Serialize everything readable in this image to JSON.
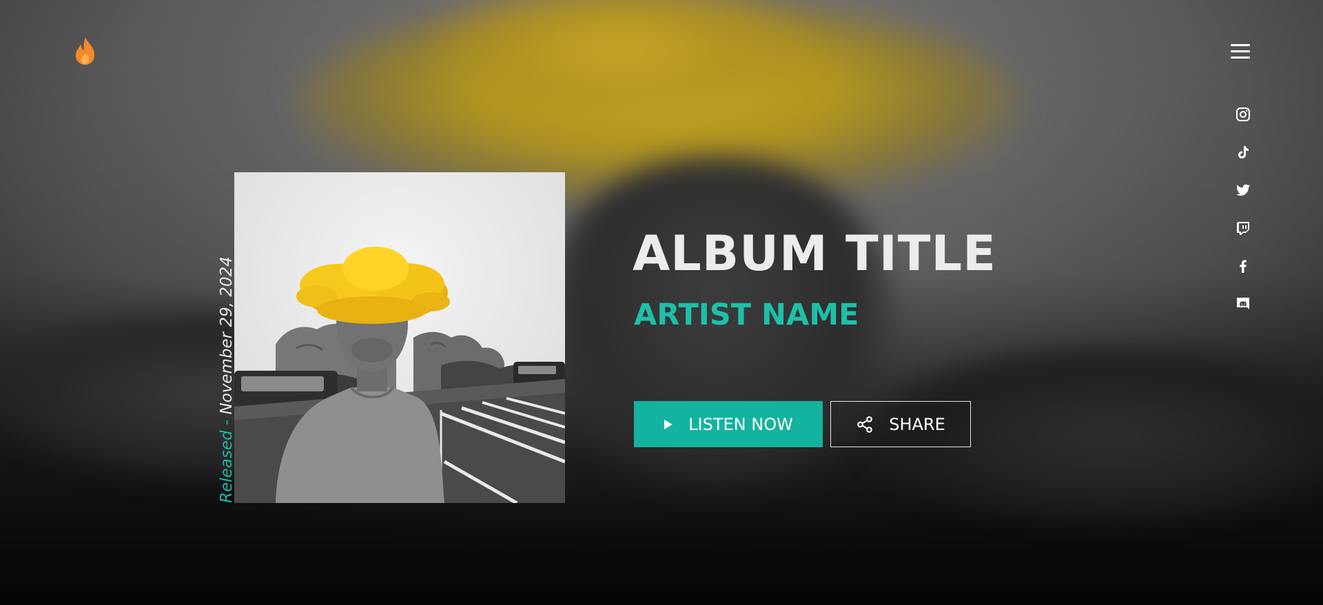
{
  "album": {
    "title": "ALBUM TITLE",
    "artist": "ARTIST NAME",
    "release_label": "Released",
    "release_separator": " - ",
    "release_date": "November 29, 2024"
  },
  "actions": {
    "listen_label": "LISTEN NOW",
    "share_label": "SHARE"
  },
  "header": {
    "logo_icon": "flame-icon",
    "menu_icon": "hamburger-menu-icon"
  },
  "social": [
    {
      "name": "instagram-icon"
    },
    {
      "name": "tiktok-icon"
    },
    {
      "name": "twitter-icon"
    },
    {
      "name": "twitch-icon"
    },
    {
      "name": "facebook-icon"
    },
    {
      "name": "discord-icon"
    }
  ],
  "colors": {
    "accent": "#14b39f",
    "artist": "#1ec0a9",
    "logo": "#f08a2a",
    "cloud": "#f2c418"
  }
}
